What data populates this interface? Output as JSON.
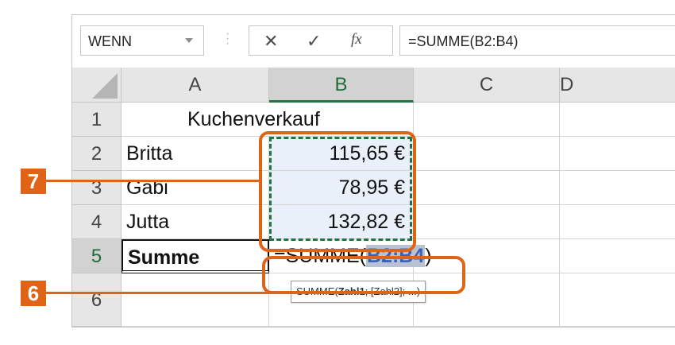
{
  "formula_bar": {
    "name_box": "WENN",
    "cancel_glyph": "✕",
    "enter_glyph": "✓",
    "fx_glyph": "fx",
    "formula": "=SUMME(B2:B4)"
  },
  "columns": [
    "A",
    "B",
    "C",
    "D"
  ],
  "rows": [
    "1",
    "2",
    "3",
    "4",
    "5",
    "6"
  ],
  "cells": {
    "A1": "Kuchenverkauf",
    "A2": "Britta",
    "B2": "115,65 €",
    "A3": "Gabi",
    "B3": "78,95 €",
    "A4": "Jutta",
    "B4": "132,82 €",
    "A5": "Summe"
  },
  "edit": {
    "prefix": "=SUMME(",
    "ref": "B2:B4",
    "suffix": ")"
  },
  "tooltip": {
    "fn": "SUMME(",
    "arg1": "Zahl1",
    "rest": "; [Zahl2]; ...)"
  },
  "callouts": {
    "a": "7",
    "b": "6"
  },
  "colors": {
    "accent_orange": "#e06418",
    "selection_green": "#217346",
    "reference_blue": "#3b62b8"
  }
}
